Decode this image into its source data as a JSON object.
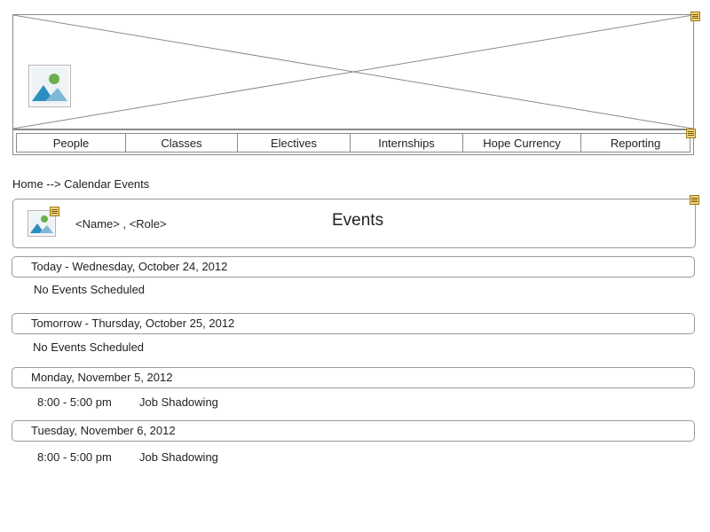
{
  "nav": {
    "items": [
      {
        "label": "People"
      },
      {
        "label": "Classes"
      },
      {
        "label": "Electives"
      },
      {
        "label": "Internships"
      },
      {
        "label": "Hope Currency"
      },
      {
        "label": "Reporting"
      }
    ]
  },
  "breadcrumb": {
    "text": "Home --> Calendar Events"
  },
  "user": {
    "name_role": "<Name> , <Role>"
  },
  "page": {
    "title": "Events"
  },
  "days": [
    {
      "header": "Today - Wednesday, October 24, 2012",
      "empty": "No Events Scheduled"
    },
    {
      "header": "Tomorrow - Thursday, October 25, 2012",
      "empty": "No Events Scheduled"
    },
    {
      "header": "Monday, November 5, 2012",
      "events": [
        {
          "time": "8:00 - 5:00 pm",
          "name": "Job Shadowing"
        }
      ]
    },
    {
      "header": "Tuesday, November 6, 2012",
      "events": [
        {
          "time": "8:00 - 5:00 pm",
          "name": "Job Shadowing"
        }
      ]
    }
  ],
  "icons": {
    "logo": "image-placeholder-icon",
    "avatar": "image-placeholder-icon",
    "note": "note-icon"
  },
  "colors": {
    "border": "#8a8a8a",
    "image_sky": "#2a8fc0",
    "image_sun": "#6ab04c",
    "note": "#c9a227"
  }
}
